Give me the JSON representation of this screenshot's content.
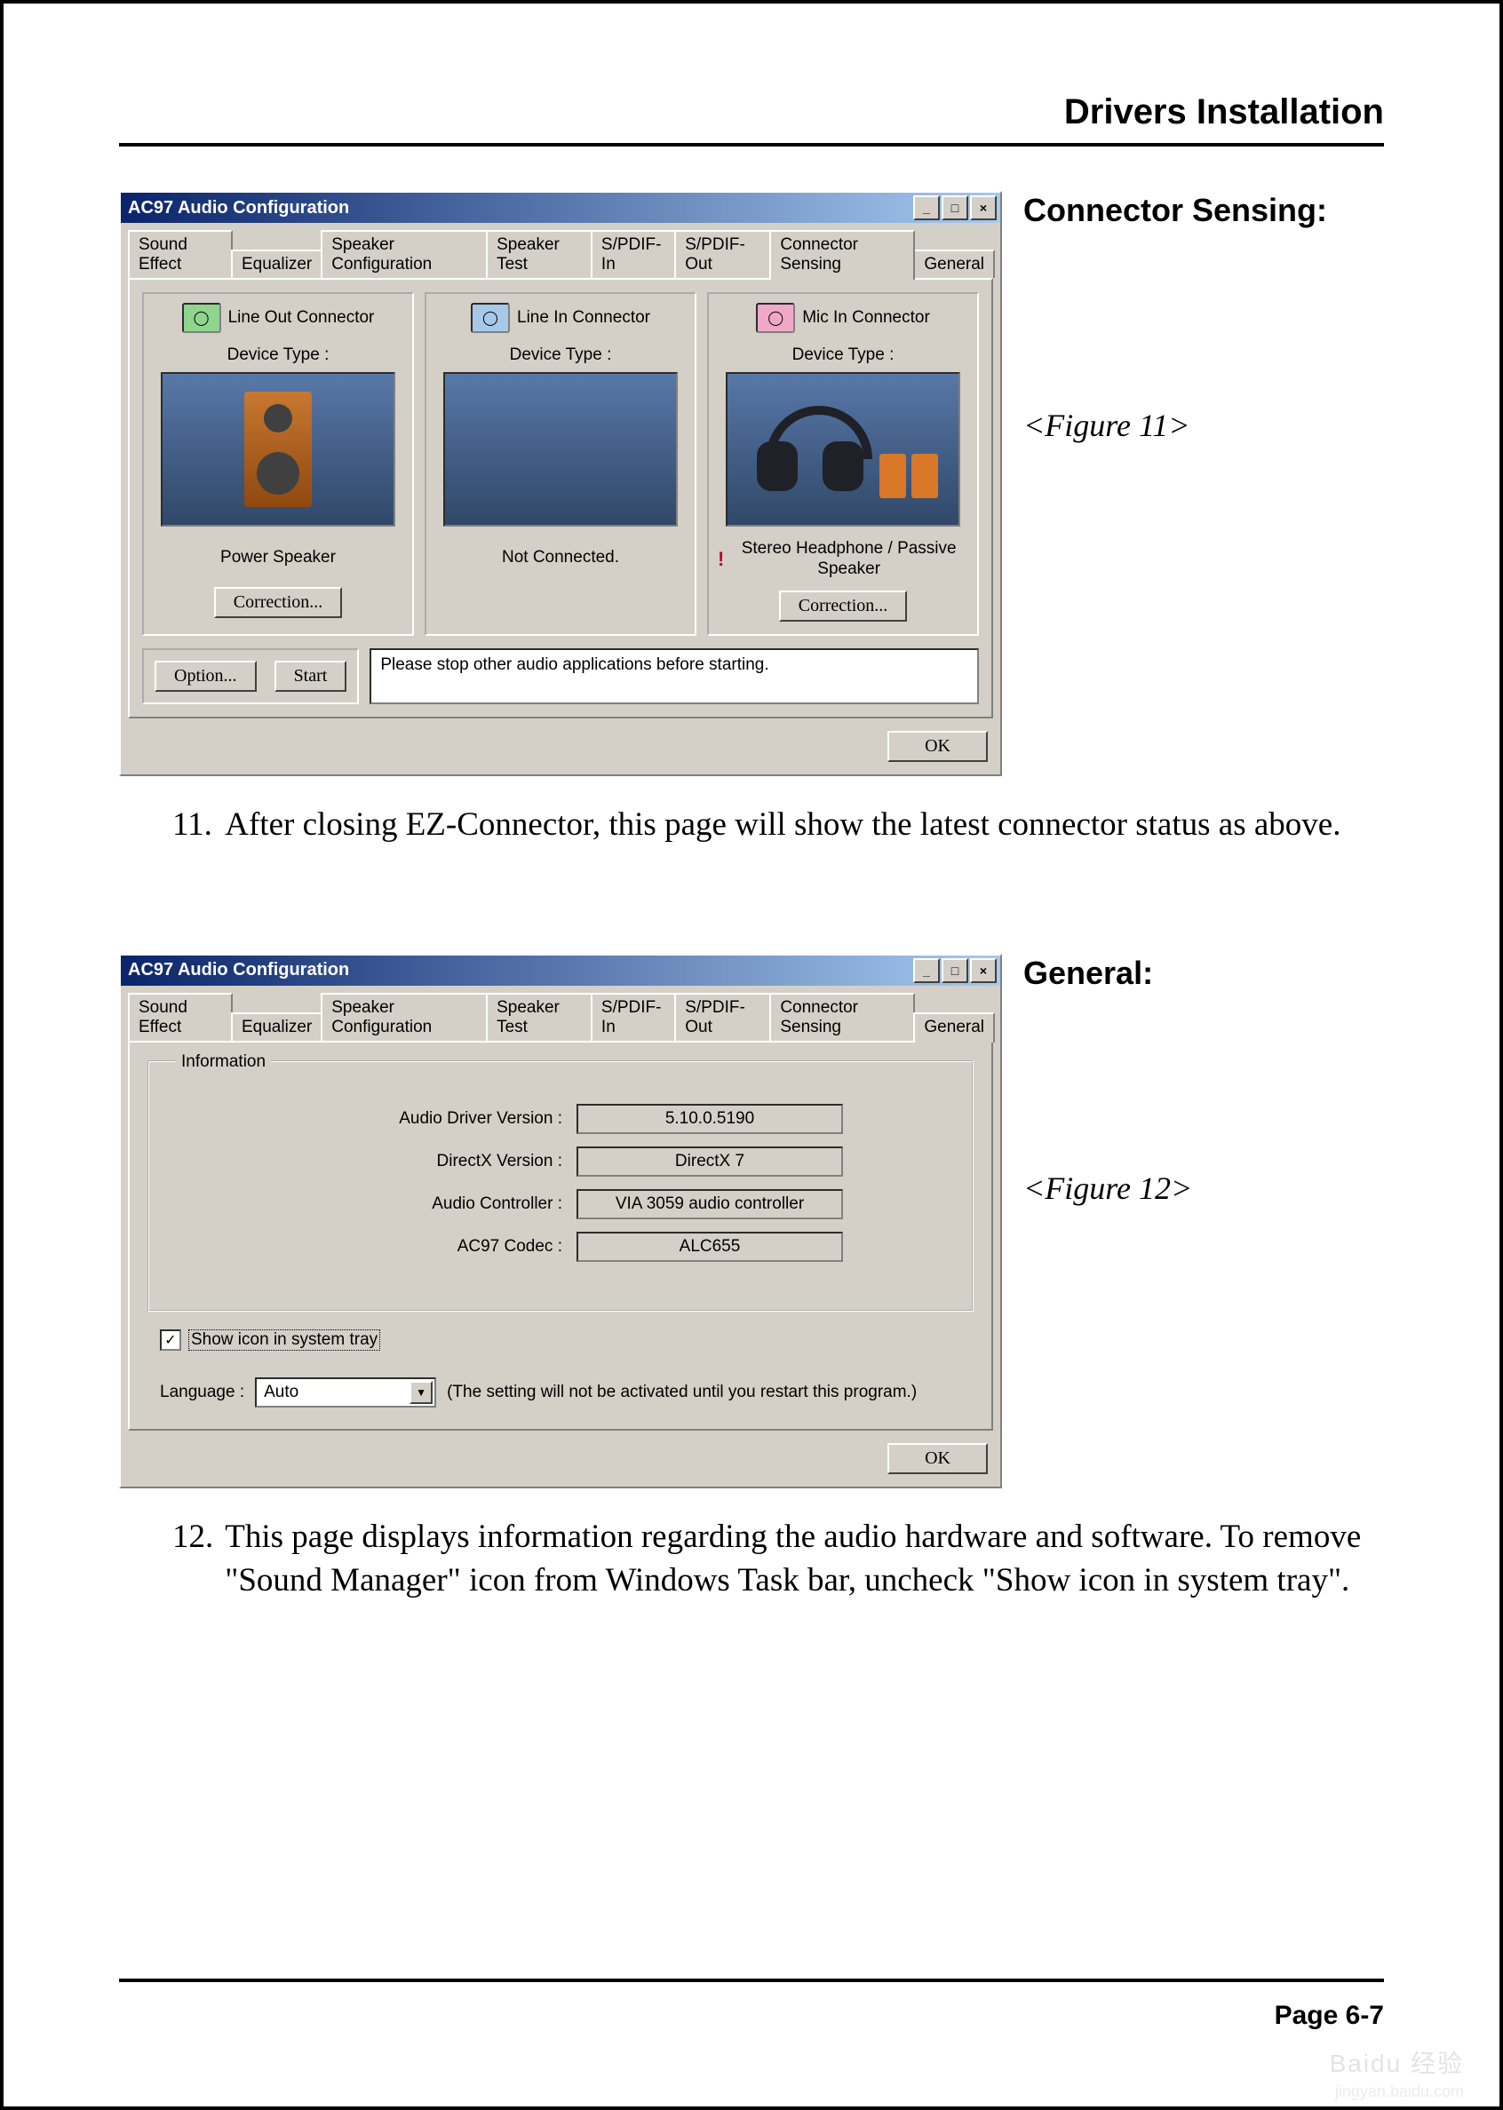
{
  "doc": {
    "header": "Drivers Installation",
    "footer_page": "Page 6-7",
    "watermark_main": "Baidu 经验",
    "watermark_sub": "jingyan.baidu.com"
  },
  "figure11": {
    "side_title": "Connector Sensing:",
    "caption": "<Figure 11>",
    "list_num": "11.",
    "list_text": "After closing EZ-Connector, this page will show the latest connector status as above.",
    "win_title": "AC97 Audio Configuration",
    "tabs": [
      "Sound Effect",
      "Equalizer",
      "Speaker Configuration",
      "Speaker Test",
      "S/PDIF-In",
      "S/PDIF-Out",
      "Connector Sensing",
      "General"
    ],
    "active_tab": "Connector Sensing",
    "connectors": [
      {
        "jack_color": "green",
        "jack_label": "Line Out Connector",
        "device_label": "Device Type :",
        "status": "Power Speaker",
        "warn": false,
        "has_correction": true
      },
      {
        "jack_color": "blue",
        "jack_label": "Line In Connector",
        "device_label": "Device Type :",
        "status": "Not Connected.",
        "warn": false,
        "has_correction": false
      },
      {
        "jack_color": "pink",
        "jack_label": "Mic In Connector",
        "device_label": "Device Type :",
        "status": "Stereo Headphone / Passive Speaker",
        "warn": true,
        "has_correction": true
      }
    ],
    "correction_btn": "Correction...",
    "option_btn": "Option...",
    "start_btn": "Start",
    "status_msg": "Please stop other audio applications before starting.",
    "ok_btn": "OK"
  },
  "figure12": {
    "side_title": "General:",
    "caption": "<Figure 12>",
    "list_num": "12.",
    "list_text": "This page displays information regarding the audio hardware and software. To remove \"Sound Manager\" icon from Windows Task bar, uncheck \"Show icon in system tray\".",
    "win_title": "AC97 Audio Configuration",
    "tabs": [
      "Sound Effect",
      "Equalizer",
      "Speaker Configuration",
      "Speaker Test",
      "S/PDIF-In",
      "S/PDIF-Out",
      "Connector Sensing",
      "General"
    ],
    "active_tab": "General",
    "fieldset_label": "Information",
    "rows": [
      {
        "lbl": "Audio Driver Version :",
        "val": "5.10.0.5190"
      },
      {
        "lbl": "DirectX Version :",
        "val": "DirectX 7"
      },
      {
        "lbl": "Audio Controller :",
        "val": "VIA 3059 audio controller"
      },
      {
        "lbl": "AC97 Codec :",
        "val": "ALC655"
      }
    ],
    "checkbox_label": "Show icon in system tray",
    "checkbox_checked": true,
    "language_label": "Language :",
    "language_value": "Auto",
    "language_note": "(The setting will not be activated until you restart this program.)",
    "ok_btn": "OK"
  }
}
